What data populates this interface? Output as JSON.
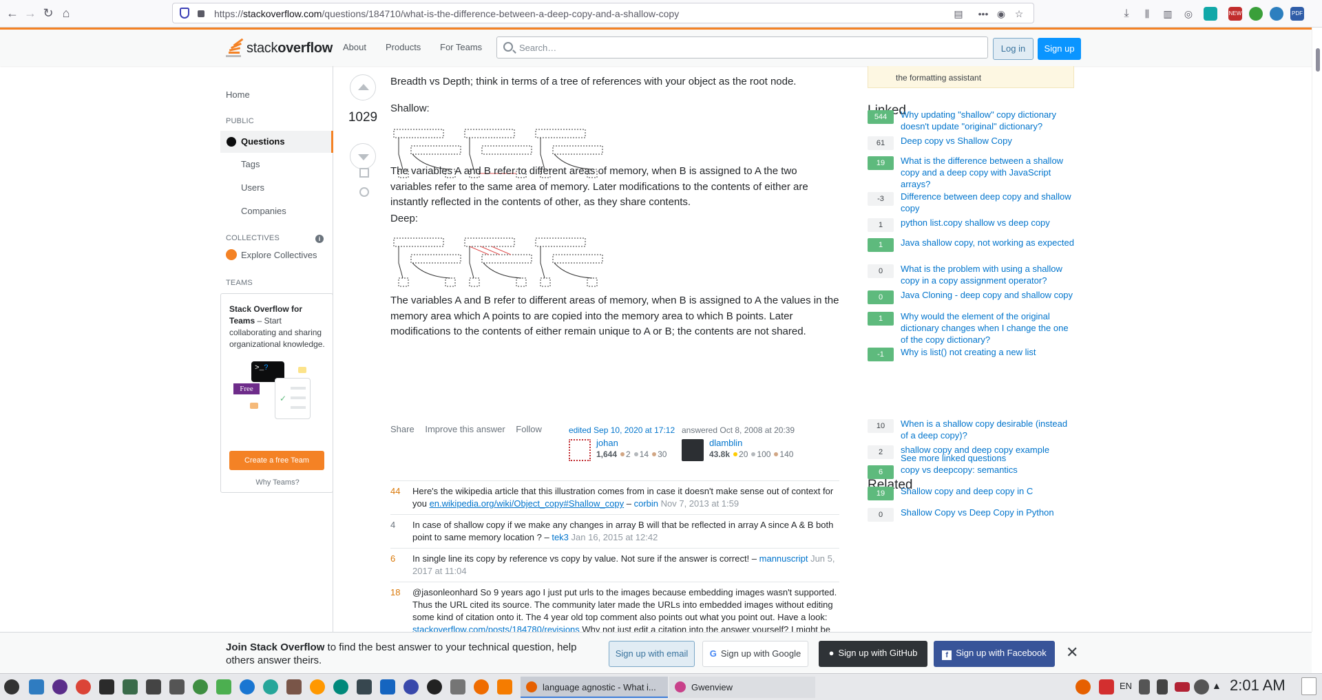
{
  "browser": {
    "url_prefix": "https://",
    "url_domain": "stackoverflow.com",
    "url_path": "/questions/184710/what-is-the-difference-between-a-deep-copy-and-a-shallow-copy",
    "toolbar_badges": {
      "new_badge": "NEW",
      "pdf_badge": "PDF"
    }
  },
  "so_header": {
    "logo_text_a": "stack",
    "logo_text_b": "overflow",
    "nav": [
      "About",
      "Products",
      "For Teams"
    ],
    "search_placeholder": "Search…",
    "login": "Log in",
    "signup": "Sign up"
  },
  "leftnav": {
    "home": "Home",
    "public_header": "PUBLIC",
    "questions": "Questions",
    "tags": "Tags",
    "users": "Users",
    "companies": "Companies",
    "collectives_header": "COLLECTIVES",
    "explore_collectives": "Explore Collectives",
    "teams_header": "TEAMS",
    "teams_title": "Stack Overflow for Teams",
    "teams_desc": " – Start collaborating and sharing organizational knowledge.",
    "free_badge": "Free",
    "create_team": "Create a free Team",
    "why_teams": "Why Teams?"
  },
  "answer": {
    "score": "1029",
    "intro": "Breadth vs Depth; think in terms of a tree of references with your object as the root node.",
    "shallow_label": "Shallow:",
    "shallow_text": "The variables A and B refer to different areas of memory, when B is assigned to A the two variables refer to the same area of memory. Later modifications to the contents of either are instantly reflected in the contents of other, as they share contents.",
    "deep_label": "Deep:",
    "deep_text": "The variables A and B refer to different areas of memory, when B is assigned to A the values in the memory area which A points to are copied into the memory area to which B points. Later modifications to the contents of either remain unique to A or B; the contents are not shared.",
    "menu": [
      "Share",
      "Improve this answer",
      "Follow"
    ],
    "editor": {
      "action": "edited Sep 10, 2020 at 17:12",
      "name": "johan",
      "rep": "1,644",
      "gold": "",
      "silver": "2",
      "bronze": "14",
      "bronze2": "30"
    },
    "author": {
      "action": "answered Oct 8, 2008 at 20:39",
      "name": "dlamblin",
      "rep": "43.8k",
      "gold": "20",
      "silver": "100",
      "bronze": "140"
    }
  },
  "comments": [
    {
      "score": "44",
      "text": "Here's the wikipedia article that this illustration comes from in case it doesn't make sense out of context for you ",
      "link": "en.wikipedia.org/wiki/Object_copy#Shallow_copy",
      "sep": " – ",
      "user": "corbin",
      "date": " Nov 7, 2013 at 1:59"
    },
    {
      "score": "4",
      "text": "In case of shallow copy if we make any changes in array B will that be reflected in array A since A & B both point to same memory location ?",
      "link": "",
      "sep": " – ",
      "user": "tek3",
      "date": " Jan 16, 2015 at 12:42"
    },
    {
      "score": "6",
      "text": "In single line its copy by reference vs copy by value. Not sure if the answer is correct!",
      "link": "",
      "sep": " – ",
      "user": "mannuscript",
      "date": " Jun 5, 2017 at 11:04"
    },
    {
      "score": "18",
      "text": "@jasonleonhard So 9 years ago I just put urls to the images because embedding images wasn't supported. Thus the URL cited its source. The community later made the URLs into embedded images without editing some kind of citation onto it. The 4 year old top comment also points out what you point out. Have a look: ",
      "link": "stackoverflow.com/posts/184780/revisions",
      "sep": "",
      "user": "",
      "date": " Why not just edit a citation into the answer yourself? I might be"
    }
  ],
  "sidebar": {
    "callout": "the formatting assistant",
    "linked_title": "Linked",
    "linked": [
      {
        "score": "544",
        "accepted": true,
        "title": "Why updating \"shallow\" copy dictionary doesn't update \"original\" dictionary?"
      },
      {
        "score": "61",
        "accepted": false,
        "title": "Deep copy vs Shallow Copy"
      },
      {
        "score": "19",
        "accepted": true,
        "title": "What is the difference between a shallow copy and a deep copy with JavaScript arrays?"
      },
      {
        "score": "-3",
        "accepted": false,
        "title": "Difference between deep copy and shallow copy"
      },
      {
        "score": "1",
        "accepted": false,
        "title": "python list.copy shallow vs deep copy"
      },
      {
        "score": "1",
        "accepted": true,
        "title": "Java shallow copy, not working as expected"
      },
      {
        "score": "0",
        "accepted": false,
        "title": "What is the problem with using a shallow copy in a copy assignment operator?"
      },
      {
        "score": "0",
        "accepted": true,
        "title": "Java Cloning - deep copy and shallow copy"
      },
      {
        "score": "1",
        "accepted": true,
        "title": "Why would the element of the original dictionary changes when I change the one of the copy dictionary?"
      },
      {
        "score": "-1",
        "accepted": true,
        "title": "Why is list() not creating a new list"
      }
    ],
    "see_more": "See more linked questions",
    "related_title": "Related",
    "related": [
      {
        "score": "10",
        "accepted": false,
        "title": "When is a shallow copy desirable (instead of a deep copy)?"
      },
      {
        "score": "2",
        "accepted": false,
        "title": "shallow copy and deep copy example"
      },
      {
        "score": "6",
        "accepted": true,
        "title": "copy vs deepcopy: semantics"
      },
      {
        "score": "19",
        "accepted": true,
        "title": "Shallow copy and deep copy in C"
      },
      {
        "score": "0",
        "accepted": false,
        "title": "Shallow Copy vs Deep Copy in Python"
      }
    ]
  },
  "banner": {
    "bold": "Join Stack Overflow",
    "text": " to find the best answer to your technical question, help others answer theirs.",
    "email": "Sign up with email",
    "google": "Sign up with Google",
    "github": "Sign up with GitHub",
    "facebook": "Sign up with Facebook",
    "close": "✕"
  },
  "taskbar": {
    "tasks": [
      "language agnostic - What i...",
      "Gwenview"
    ],
    "lang": "EN",
    "clock": "2:01 AM"
  }
}
